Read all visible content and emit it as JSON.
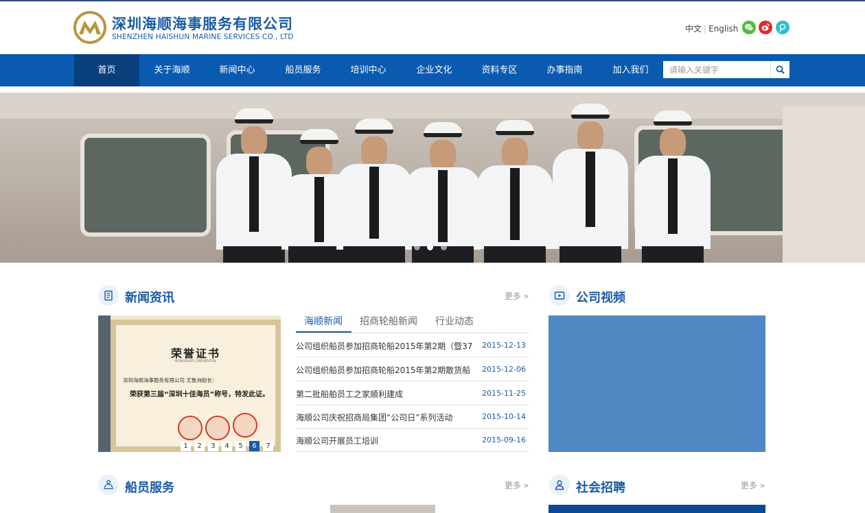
{
  "colors": {
    "brand_blue": "#1a5aa6",
    "nav_bg": "#0a5ab0",
    "nav_active_bg": "#0a3f7e",
    "video_bg": "#4f88c2",
    "date_color": "#1a5aa6",
    "logo_gold": "#b8963e"
  },
  "header": {
    "company_cn": "深圳海顺海事服务有限公司",
    "company_en": "SHENZHEN HAISHUN MARINE SERVICES CO., LTD",
    "lang": {
      "zh": "中文",
      "en": "English"
    },
    "social_icons": [
      "wechat-icon",
      "weibo-icon",
      "tencent-weibo-icon"
    ]
  },
  "nav": {
    "items": [
      {
        "label": "首页",
        "active": true
      },
      {
        "label": "关于海顺"
      },
      {
        "label": "新闻中心"
      },
      {
        "label": "船员服务"
      },
      {
        "label": "培训中心"
      },
      {
        "label": "企业文化"
      },
      {
        "label": "资料专区"
      },
      {
        "label": "办事指南"
      },
      {
        "label": "加入我们"
      }
    ],
    "search": {
      "placeholder": "请输入关键字",
      "icon": "search-icon"
    }
  },
  "banner": {
    "slide_count": 3,
    "active_slide": 2
  },
  "news": {
    "title": "新闻资讯",
    "more": "更多 »",
    "image": {
      "cert_title": "荣誉证书",
      "cert_subtitle": "HONORARY CREDENTIAL",
      "cert_line1": "深圳海顺海事服务有限公司 尤鲁洲船长：",
      "cert_line2": "荣获第三届“深圳十佳海员”称号，特发此证。"
    },
    "pager": [
      "1",
      "2",
      "3",
      "4",
      "5",
      "6",
      "7"
    ],
    "pager_active": 6,
    "tabs": [
      "海顺新闻",
      "招商轮船新闻",
      "行业动态"
    ],
    "active_tab": 0,
    "items": [
      {
        "title": "公司组织船员参加招商轮船2015年第2期（暨37",
        "date": "2015-12-13"
      },
      {
        "title": "公司组织船员参加招商轮船2015年第2期散货船",
        "date": "2015-12-06"
      },
      {
        "title": "第二批船舶员工之家顺利建成",
        "date": "2015-11-25"
      },
      {
        "title": "海顺公司庆祝招商局集团“公司日”系列活动",
        "date": "2015-10-14"
      },
      {
        "title": "海顺公司开展员工培训",
        "date": "2015-09-16"
      }
    ]
  },
  "video": {
    "title": "公司视频"
  },
  "crew": {
    "title": "船员服务",
    "more": "更多 »"
  },
  "recruit": {
    "title": "社会招聘",
    "more": "更多 »"
  }
}
